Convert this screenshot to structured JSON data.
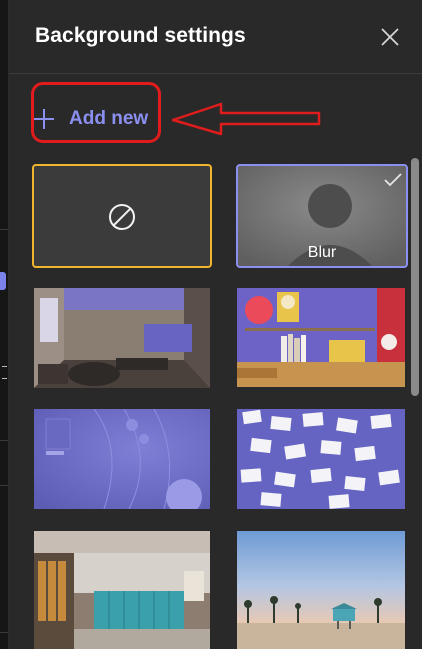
{
  "header": {
    "title": "Background settings"
  },
  "actions": {
    "add_new_label": "Add new"
  },
  "backgrounds": {
    "blur_label": "Blur",
    "selected": "Blur"
  },
  "colors": {
    "accent": "#8b8ff0",
    "none_outline": "#f0b52c",
    "annotation": "#e01c1c",
    "panel": "#292929"
  },
  "icons": [
    "close-icon",
    "plus-icon",
    "none-icon",
    "checkmark-icon",
    "arrow-annotation"
  ]
}
